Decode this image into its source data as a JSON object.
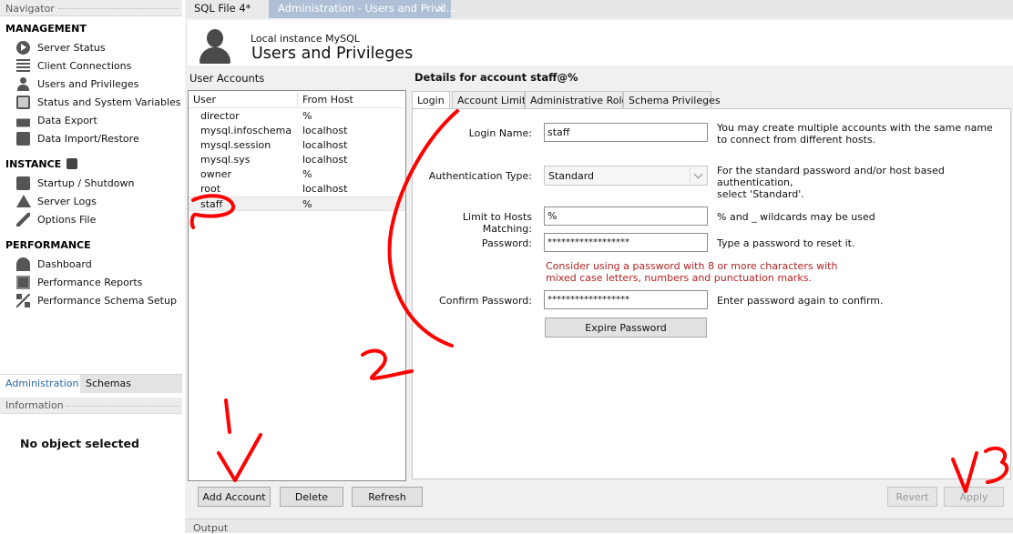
{
  "navigator": {
    "title": "Navigator",
    "management": {
      "heading": "MANAGEMENT",
      "items": [
        {
          "label": "Server Status",
          "icon": "play-circle-icon"
        },
        {
          "label": "Client Connections",
          "icon": "list-icon"
        },
        {
          "label": "Users and Privileges",
          "icon": "user-icon"
        },
        {
          "label": "Status and System Variables",
          "icon": "monitor-icon"
        },
        {
          "label": "Data Export",
          "icon": "export-icon"
        },
        {
          "label": "Data Import/Restore",
          "icon": "import-icon"
        }
      ]
    },
    "instance": {
      "heading": "INSTANCE",
      "items": [
        {
          "label": "Startup / Shutdown",
          "icon": "startup-icon"
        },
        {
          "label": "Server Logs",
          "icon": "warning-icon"
        },
        {
          "label": "Options File",
          "icon": "wrench-icon"
        }
      ]
    },
    "performance": {
      "heading": "PERFORMANCE",
      "items": [
        {
          "label": "Dashboard",
          "icon": "dashboard-icon"
        },
        {
          "label": "Performance Reports",
          "icon": "reports-icon"
        },
        {
          "label": "Performance Schema Setup",
          "icon": "schema-setup-icon"
        }
      ]
    },
    "tabs": [
      "Administration",
      "Schemas"
    ],
    "information_title": "Information",
    "no_object": "No object selected"
  },
  "tabs": {
    "sql_file": "SQL File 4*",
    "admin": "Administration - Users and Privil...",
    "close": "×"
  },
  "header": {
    "subtitle": "Local instance MySQL",
    "title": "Users and Privileges"
  },
  "accounts": {
    "label": "User Accounts",
    "col_user": "User",
    "col_host": "From Host",
    "rows": [
      {
        "user": "director",
        "host": "%"
      },
      {
        "user": "mysql.infoschema",
        "host": "localhost"
      },
      {
        "user": "mysql.session",
        "host": "localhost"
      },
      {
        "user": "mysql.sys",
        "host": "localhost"
      },
      {
        "user": "owner",
        "host": "%"
      },
      {
        "user": "root",
        "host": "localhost"
      },
      {
        "user": "staff",
        "host": "%"
      }
    ]
  },
  "details": {
    "title": "Details for account staff@%",
    "tabs": [
      "Login",
      "Account Limits",
      "Administrative Roles",
      "Schema Privileges"
    ],
    "login_name_label": "Login Name:",
    "login_name_value": "staff",
    "login_help_1": "You may create multiple accounts with the same name",
    "login_help_2": "to connect from different hosts.",
    "auth_label": "Authentication Type:",
    "auth_value": "Standard",
    "auth_help_1": "For the standard password and/or host based authentication,",
    "auth_help_2": "select 'Standard'.",
    "hosts_label": "Limit to Hosts Matching:",
    "hosts_value": "%",
    "hosts_help": "% and _ wildcards may be used",
    "password_label": "Password:",
    "password_value": "******************",
    "password_help": "Type a password to reset it.",
    "warning_1": "Consider using a password with 8 or more characters with",
    "warning_2": "mixed case letters, numbers and punctuation marks.",
    "confirm_label": "Confirm Password:",
    "confirm_value": "******************",
    "confirm_help": "Enter password again to confirm.",
    "expire_button": "Expire Password"
  },
  "buttons": {
    "add_account": "Add Account",
    "delete": "Delete",
    "refresh": "Refresh",
    "revert": "Revert",
    "apply": "Apply"
  },
  "output": {
    "label": "Output"
  },
  "annotations": {
    "color": "#ff0000",
    "mark_1": "1",
    "mark_2": "2",
    "mark_3": "3"
  }
}
